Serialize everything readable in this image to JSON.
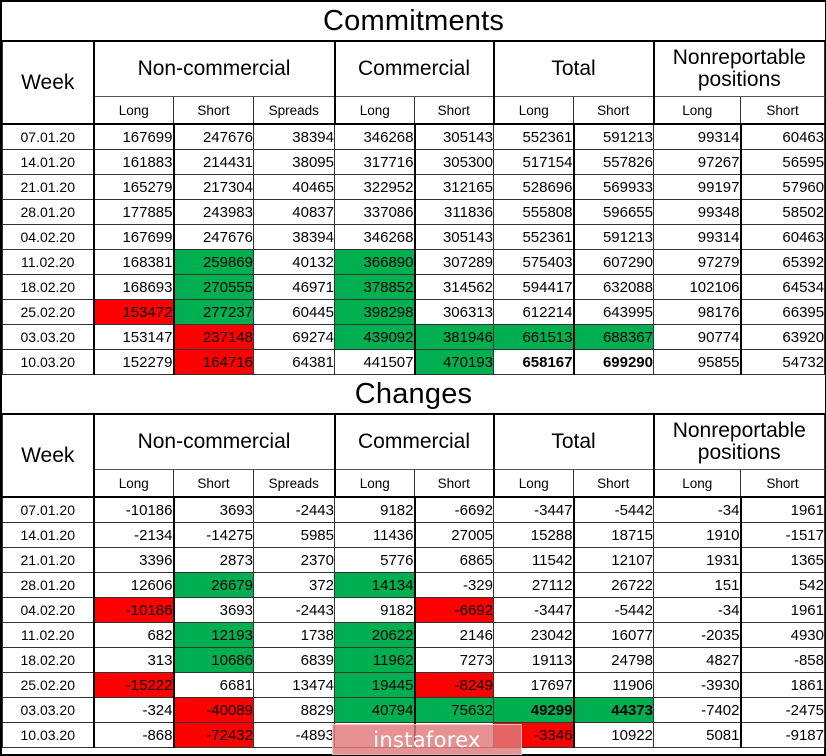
{
  "watermark": {
    "text": "instaforex"
  },
  "colors": {
    "green": "#00b050",
    "red": "#ff0000",
    "text": "#000000",
    "background": "#ffffff"
  },
  "columns": {
    "week_label": "Week",
    "groups": [
      {
        "label": "Non-commercial",
        "subs": [
          "Long",
          "Short",
          "Spreads"
        ]
      },
      {
        "label": "Commercial",
        "subs": [
          "Long",
          "Short"
        ]
      },
      {
        "label": "Total",
        "subs": [
          "Long",
          "Short"
        ]
      },
      {
        "label": "Nonreportable positions",
        "subs": [
          "Long",
          "Short"
        ]
      }
    ]
  },
  "tables": [
    {
      "title": "Commitments",
      "rows": [
        {
          "week": "07.01.20",
          "cells": [
            {
              "v": "167699"
            },
            {
              "v": "247676"
            },
            {
              "v": "38394"
            },
            {
              "v": "346268"
            },
            {
              "v": "305143"
            },
            {
              "v": "552361"
            },
            {
              "v": "591213"
            },
            {
              "v": "99314"
            },
            {
              "v": "60463"
            }
          ]
        },
        {
          "week": "14.01.20",
          "cells": [
            {
              "v": "161883"
            },
            {
              "v": "214431"
            },
            {
              "v": "38095"
            },
            {
              "v": "317716"
            },
            {
              "v": "305300"
            },
            {
              "v": "517154"
            },
            {
              "v": "557826"
            },
            {
              "v": "97267"
            },
            {
              "v": "56595"
            }
          ]
        },
        {
          "week": "21.01.20",
          "cells": [
            {
              "v": "165279"
            },
            {
              "v": "217304"
            },
            {
              "v": "40465"
            },
            {
              "v": "322952"
            },
            {
              "v": "312165"
            },
            {
              "v": "528696"
            },
            {
              "v": "569933"
            },
            {
              "v": "99197"
            },
            {
              "v": "57960"
            }
          ]
        },
        {
          "week": "28.01.20",
          "cells": [
            {
              "v": "177885"
            },
            {
              "v": "243983"
            },
            {
              "v": "40837"
            },
            {
              "v": "337086"
            },
            {
              "v": "311836"
            },
            {
              "v": "555808"
            },
            {
              "v": "596655"
            },
            {
              "v": "99348"
            },
            {
              "v": "58502"
            }
          ]
        },
        {
          "week": "04.02.20",
          "cells": [
            {
              "v": "167699"
            },
            {
              "v": "247676"
            },
            {
              "v": "38394"
            },
            {
              "v": "346268"
            },
            {
              "v": "305143"
            },
            {
              "v": "552361"
            },
            {
              "v": "591213"
            },
            {
              "v": "99314"
            },
            {
              "v": "60463"
            }
          ]
        },
        {
          "week": "11.02.20",
          "cells": [
            {
              "v": "168381"
            },
            {
              "v": "259869",
              "h": "green"
            },
            {
              "v": "40132"
            },
            {
              "v": "366890",
              "h": "green"
            },
            {
              "v": "307289"
            },
            {
              "v": "575403"
            },
            {
              "v": "607290"
            },
            {
              "v": "97279"
            },
            {
              "v": "65392"
            }
          ]
        },
        {
          "week": "18.02.20",
          "cells": [
            {
              "v": "168693"
            },
            {
              "v": "270555",
              "h": "green"
            },
            {
              "v": "46971"
            },
            {
              "v": "378852",
              "h": "green"
            },
            {
              "v": "314562"
            },
            {
              "v": "594417"
            },
            {
              "v": "632088"
            },
            {
              "v": "102106"
            },
            {
              "v": "64534"
            }
          ]
        },
        {
          "week": "25.02.20",
          "cells": [
            {
              "v": "153472",
              "h": "red"
            },
            {
              "v": "277237",
              "h": "green"
            },
            {
              "v": "60445"
            },
            {
              "v": "398298",
              "h": "green"
            },
            {
              "v": "306313"
            },
            {
              "v": "612214"
            },
            {
              "v": "643995"
            },
            {
              "v": "98176"
            },
            {
              "v": "66395"
            }
          ]
        },
        {
          "week": "03.03.20",
          "cells": [
            {
              "v": "153147"
            },
            {
              "v": "237148",
              "h": "red"
            },
            {
              "v": "69274"
            },
            {
              "v": "439092",
              "h": "green"
            },
            {
              "v": "381946",
              "h": "green"
            },
            {
              "v": "661513",
              "h": "green"
            },
            {
              "v": "688367",
              "h": "green"
            },
            {
              "v": "90774"
            },
            {
              "v": "63920"
            }
          ]
        },
        {
          "week": "10.03.20",
          "cells": [
            {
              "v": "152279"
            },
            {
              "v": "164716",
              "h": "red"
            },
            {
              "v": "64381"
            },
            {
              "v": "441507"
            },
            {
              "v": "470193",
              "h": "green"
            },
            {
              "v": "658167",
              "b": true
            },
            {
              "v": "699290",
              "b": true
            },
            {
              "v": "95855"
            },
            {
              "v": "54732"
            }
          ]
        }
      ]
    },
    {
      "title": "Changes",
      "rows": [
        {
          "week": "07.01.20",
          "cells": [
            {
              "v": "-10186"
            },
            {
              "v": "3693"
            },
            {
              "v": "-2443"
            },
            {
              "v": "9182"
            },
            {
              "v": "-6692"
            },
            {
              "v": "-3447"
            },
            {
              "v": "-5442"
            },
            {
              "v": "-34"
            },
            {
              "v": "1961"
            }
          ]
        },
        {
          "week": "14.01.20",
          "cells": [
            {
              "v": "-2134"
            },
            {
              "v": "-14275"
            },
            {
              "v": "5985"
            },
            {
              "v": "11436"
            },
            {
              "v": "27005"
            },
            {
              "v": "15288"
            },
            {
              "v": "18715"
            },
            {
              "v": "1910"
            },
            {
              "v": "-1517"
            }
          ]
        },
        {
          "week": "21.01.20",
          "cells": [
            {
              "v": "3396"
            },
            {
              "v": "2873"
            },
            {
              "v": "2370"
            },
            {
              "v": "5776"
            },
            {
              "v": "6865"
            },
            {
              "v": "11542"
            },
            {
              "v": "12107"
            },
            {
              "v": "1931"
            },
            {
              "v": "1365"
            }
          ]
        },
        {
          "week": "28.01.20",
          "cells": [
            {
              "v": "12606"
            },
            {
              "v": "26679",
              "h": "green"
            },
            {
              "v": "372"
            },
            {
              "v": "14134",
              "h": "green"
            },
            {
              "v": "-329"
            },
            {
              "v": "27112"
            },
            {
              "v": "26722"
            },
            {
              "v": "151"
            },
            {
              "v": "542"
            }
          ]
        },
        {
          "week": "04.02.20",
          "cells": [
            {
              "v": "-10186",
              "h": "red"
            },
            {
              "v": "3693"
            },
            {
              "v": "-2443"
            },
            {
              "v": "9182"
            },
            {
              "v": "-6692",
              "h": "red"
            },
            {
              "v": "-3447"
            },
            {
              "v": "-5442"
            },
            {
              "v": "-34"
            },
            {
              "v": "1961"
            }
          ]
        },
        {
          "week": "11.02.20",
          "cells": [
            {
              "v": "682"
            },
            {
              "v": "12193",
              "h": "green"
            },
            {
              "v": "1738"
            },
            {
              "v": "20622",
              "h": "green"
            },
            {
              "v": "2146"
            },
            {
              "v": "23042"
            },
            {
              "v": "16077"
            },
            {
              "v": "-2035"
            },
            {
              "v": "4930"
            }
          ]
        },
        {
          "week": "18.02.20",
          "cells": [
            {
              "v": "313"
            },
            {
              "v": "10686",
              "h": "green"
            },
            {
              "v": "6839"
            },
            {
              "v": "11962",
              "h": "green"
            },
            {
              "v": "7273"
            },
            {
              "v": "19113"
            },
            {
              "v": "24798"
            },
            {
              "v": "4827"
            },
            {
              "v": "-858"
            }
          ]
        },
        {
          "week": "25.02.20",
          "cells": [
            {
              "v": "-15222",
              "h": "red"
            },
            {
              "v": "6681"
            },
            {
              "v": "13474"
            },
            {
              "v": "19445",
              "h": "green"
            },
            {
              "v": "-8249",
              "h": "red"
            },
            {
              "v": "17697"
            },
            {
              "v": "11906"
            },
            {
              "v": "-3930"
            },
            {
              "v": "1861"
            }
          ]
        },
        {
          "week": "03.03.20",
          "cells": [
            {
              "v": "-324"
            },
            {
              "v": "-40089",
              "h": "red"
            },
            {
              "v": "8829"
            },
            {
              "v": "40794",
              "h": "green"
            },
            {
              "v": "75632",
              "h": "green"
            },
            {
              "v": "49299",
              "h": "green",
              "b": true
            },
            {
              "v": "44373",
              "h": "green",
              "b": true
            },
            {
              "v": "-7402"
            },
            {
              "v": "-2475"
            }
          ]
        },
        {
          "week": "10.03.20",
          "cells": [
            {
              "v": "-868"
            },
            {
              "v": "-72432",
              "h": "red"
            },
            {
              "v": "-4893"
            },
            {
              "v": ""
            },
            {
              "v": ""
            },
            {
              "v": "-3346",
              "h": "red"
            },
            {
              "v": "10922"
            },
            {
              "v": "5081"
            },
            {
              "v": "-9187"
            }
          ]
        }
      ]
    }
  ]
}
